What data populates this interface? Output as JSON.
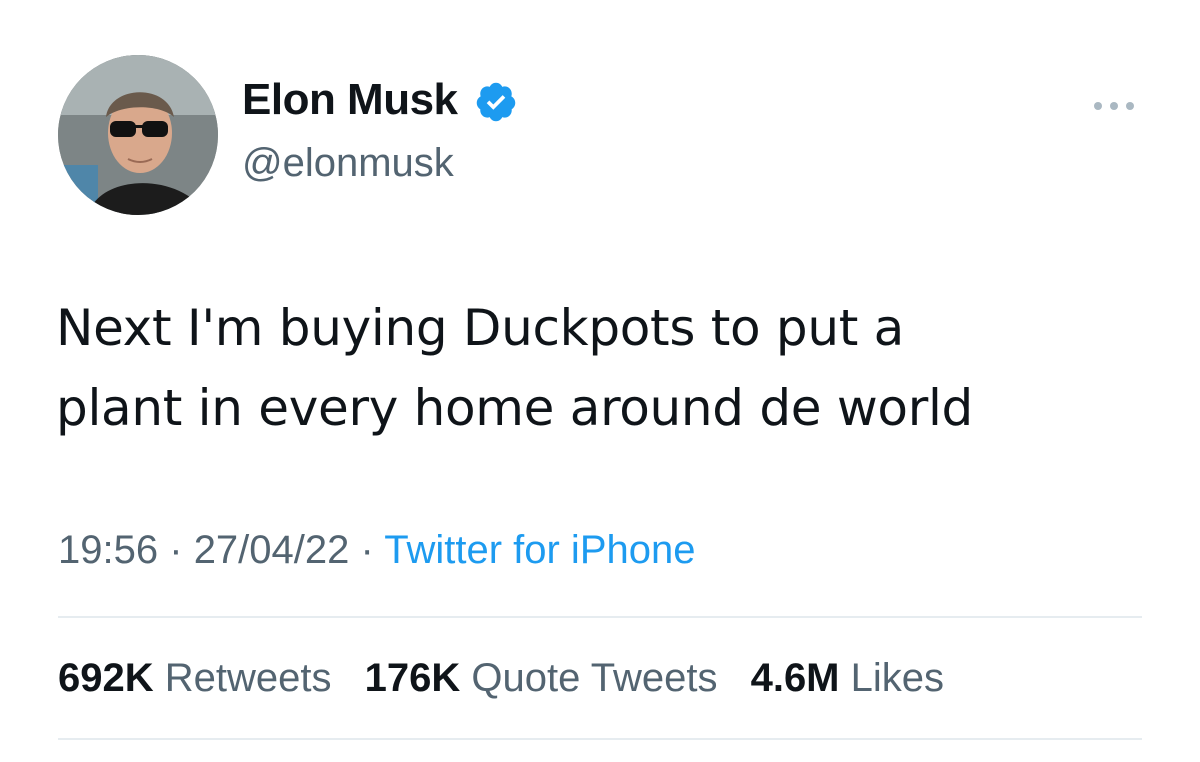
{
  "author": {
    "display_name": "Elon Musk",
    "handle": "@elonmusk",
    "verified": true,
    "avatar_icon": "profile-photo"
  },
  "tweet": {
    "text_line1": "Next I'm buying Duckpots to put a",
    "text_line2": "plant in every home around de world"
  },
  "meta": {
    "time": "19:56",
    "date": "27/04/22",
    "separator": "·",
    "source": "Twitter for iPhone"
  },
  "stats": {
    "retweets_count": "692K",
    "retweets_label": "Retweets",
    "quotes_count": "176K",
    "quotes_label": "Quote Tweets",
    "likes_count": "4.6M",
    "likes_label": "Likes"
  },
  "colors": {
    "text_primary": "#0f1419",
    "text_secondary": "#536471",
    "accent": "#1d9bf0",
    "divider": "#e6ecf0"
  },
  "icons": {
    "verified": "verified-badge-icon",
    "more": "more-options-icon"
  }
}
